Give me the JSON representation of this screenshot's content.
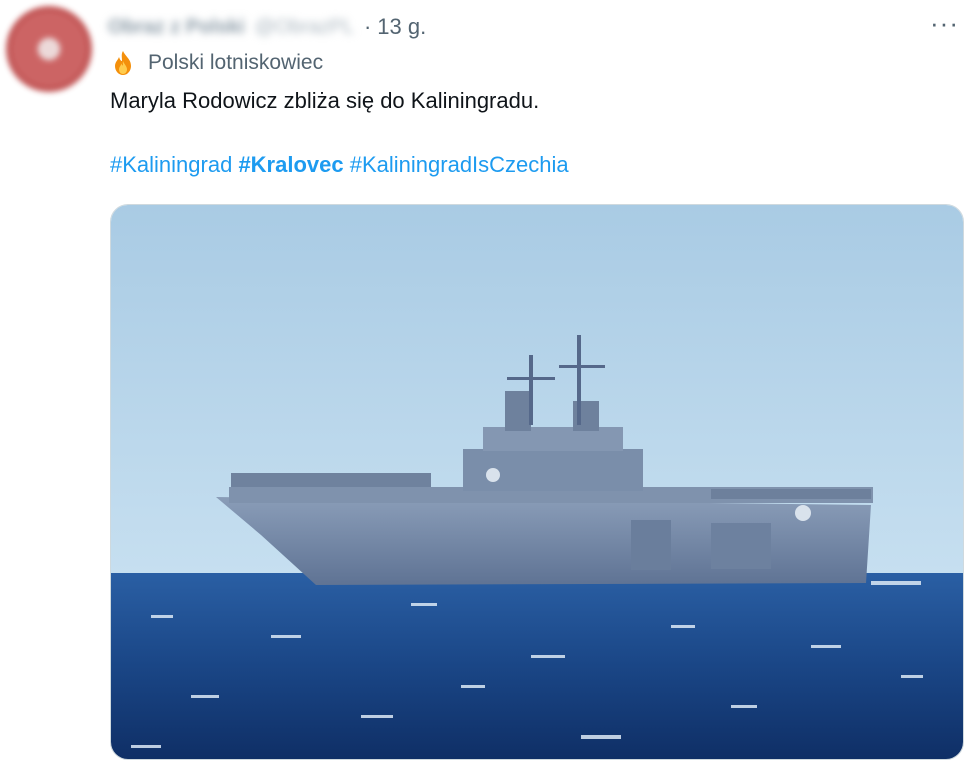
{
  "tweet": {
    "author_name": "Obraz z Polski",
    "author_handle": "@ObrazPL",
    "separator": "·",
    "timestamp": "13 g.",
    "more_label": "···",
    "context_icon": "fire-emoji-icon",
    "context_label": "Polski lotniskowiec",
    "text": "Maryla Rodowicz zbliża się do Kaliningradu.",
    "hashtags": [
      "#Kaliningrad",
      "#Kralovec",
      "#KaliningradIsCzechia"
    ]
  },
  "media": {
    "subject": "amphibious-assault-ship-photo",
    "sky_color": "#b9d7ec",
    "sea_color": "#1f4f94"
  },
  "colors": {
    "link": "#1d9bf0",
    "secondary_text": "#536471",
    "primary_text": "#0f1419"
  }
}
